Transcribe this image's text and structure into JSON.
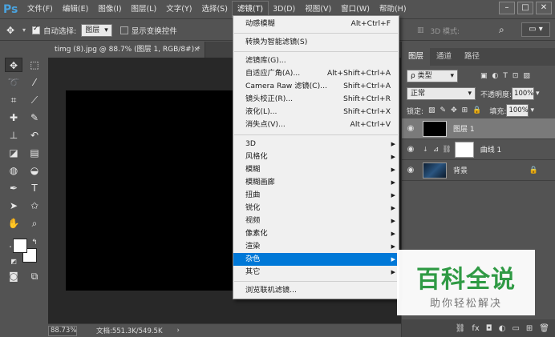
{
  "app": {
    "logo": "Ps"
  },
  "menubar": {
    "items": [
      "文件(F)",
      "编辑(E)",
      "图像(I)",
      "图层(L)",
      "文字(Y)",
      "选择(S)",
      "滤镜(T)",
      "3D(D)",
      "视图(V)",
      "窗口(W)",
      "帮助(H)"
    ],
    "active_index": 6
  },
  "window_controls": {
    "minimize": "–",
    "restore": "□",
    "close": "✕"
  },
  "options_bar": {
    "auto_select_label": "自动选择:",
    "auto_select_checked": true,
    "auto_select_value": "图层",
    "show_transform_label": "显示变换控件",
    "show_transform_checked": false,
    "mode_3d_label": "3D 模式:",
    "workspace_icon": "workspace-icon"
  },
  "document": {
    "tab_title": "timg (8).jpg @ 88.7% (图层 1, RGB/8#) *",
    "tab_close": "×",
    "zoom": "88.73%",
    "doc_info": "文档:551.3K/549.5K",
    "canvas_color": "#000000"
  },
  "filter_menu": {
    "items": [
      {
        "label": "动感模糊",
        "shortcut": "Alt+Ctrl+F"
      },
      {
        "separator": true
      },
      {
        "label": "转换为智能滤镜(S)"
      },
      {
        "separator": true
      },
      {
        "label": "滤镜库(G)..."
      },
      {
        "label": "自适应广角(A)...",
        "shortcut": "Alt+Shift+Ctrl+A"
      },
      {
        "label": "Camera Raw 滤镜(C)...",
        "shortcut": "Shift+Ctrl+A"
      },
      {
        "label": "镜头校正(R)...",
        "shortcut": "Shift+Ctrl+R"
      },
      {
        "label": "液化(L)...",
        "shortcut": "Shift+Ctrl+X"
      },
      {
        "label": "消失点(V)...",
        "shortcut": "Alt+Ctrl+V"
      },
      {
        "separator": true
      },
      {
        "label": "3D",
        "submenu": true
      },
      {
        "label": "风格化",
        "submenu": true
      },
      {
        "label": "模糊",
        "submenu": true
      },
      {
        "label": "模糊画廊",
        "submenu": true
      },
      {
        "label": "扭曲",
        "submenu": true
      },
      {
        "label": "锐化",
        "submenu": true
      },
      {
        "label": "视频",
        "submenu": true
      },
      {
        "label": "像素化",
        "submenu": true
      },
      {
        "label": "渲染",
        "submenu": true
      },
      {
        "label": "杂色",
        "submenu": true,
        "highlighted": true
      },
      {
        "label": "其它",
        "submenu": true
      },
      {
        "separator": true
      },
      {
        "label": "浏览联机滤镜..."
      }
    ]
  },
  "layers_panel": {
    "tabs": [
      "图层",
      "通道",
      "路径"
    ],
    "active_tab": 0,
    "filter_label": "ρ 类型",
    "blend_mode": "正常",
    "opacity_label": "不透明度:",
    "opacity_value": "100%",
    "lock_label": "锁定:",
    "fill_label": "填充:",
    "fill_value": "100%",
    "layers": [
      {
        "name": "图层 1",
        "selected": true,
        "thumb": "#000000"
      },
      {
        "name": "曲线 1",
        "selected": false,
        "thumb": "#ffffff",
        "adjustment": true
      },
      {
        "name": "背景",
        "selected": false,
        "thumb": "#1a3a5c",
        "locked": true
      }
    ]
  },
  "watermark": {
    "title": "百科全说",
    "subtitle": "助你轻松解决"
  }
}
